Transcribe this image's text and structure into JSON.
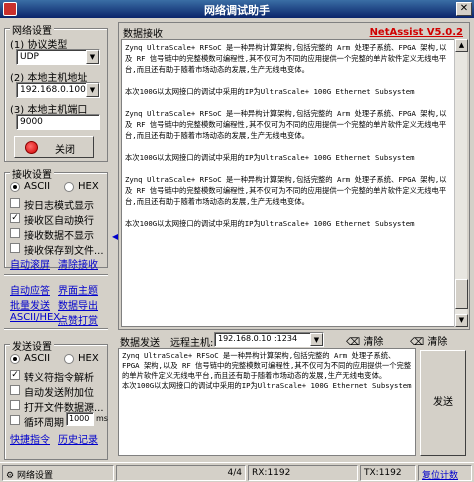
{
  "window": {
    "title": "网络调试助手",
    "close": "✕"
  },
  "net_settings": {
    "legend": "网络设置",
    "protocol_label": "(1) 协议类型",
    "protocol_value": "UDP",
    "local_ip_label": "(2) 本地主机地址",
    "local_ip_value": "192.168.0.100",
    "local_port_label": "(3) 本地主机端口",
    "local_port_value": "9000",
    "open_button": "关闭"
  },
  "recv_settings": {
    "legend": "接收设置",
    "ascii": "ASCII",
    "hex": "HEX",
    "options": [
      "按日志模式显示",
      "接收区自动换行",
      "接收数据不显示",
      "接收保存到文件..."
    ],
    "checked": [
      false,
      true,
      false,
      false
    ],
    "auto_scroll": "自动滚屏",
    "clear_recv": "清除接收"
  },
  "mid_links": {
    "row1": [
      "自动应答",
      "界面主题"
    ],
    "row2": [
      "批量发送",
      "数据导出"
    ],
    "row3": [
      "ASCII/HEX",
      "点赞打赏"
    ]
  },
  "send_settings": {
    "legend": "发送设置",
    "ascii": "ASCII",
    "hex": "HEX",
    "options": [
      "转义符指令解析",
      "自动发送附加位",
      "打开文件数据源...",
      "循环周期"
    ],
    "checked": [
      true,
      false,
      false,
      false
    ],
    "cycle_value": "1000",
    "cycle_unit": "ms",
    "quick_cmd": "快捷指令",
    "history": "历史记录"
  },
  "receive_panel": {
    "title": "数据接收",
    "brand": "NetAssist V5.0.2",
    "paragraphs": [
      "Zynq UltraScale+ RFSoC 是一种异构计算架构,包括完整的 Arm 处理子系统、FPGA 架构,以及 RF 信号链中的完整模数可编程性,其不仅可为不同的应用提供一个完整的单片软件定义无线电平台,而且还有助于随着市场动态的发展,生产无线电变体。",
      "本次100G以太网接口的调试中采用的IP为UltraScale+ 100G Ethernet Subsystem",
      "Zynq UltraScale+ RFSoC 是一种异构计算架构,包括完整的 Arm 处理子系统、FPGA 架构,以及 RF 信号链中的完整模数可编程性,其不仅可为不同的应用提供一个完整的单片软件定义无线电平台,而且还有助于随着市场动态的发展,生产无线电变体。",
      "本次100G以太网接口的调试中采用的IP为UltraScale+ 100G Ethernet Subsystem",
      "Zynq UltraScale+ RFSoC 是一种异构计算架构,包括完整的 Arm 处理子系统、FPGA 架构,以及 RF 信号链中的完整模数可编程性,其不仅可为不同的应用提供一个完整的单片软件定义无线电平台,而且还有助于随着市场动态的发展,生产无线电变体。",
      "本次100G以太网接口的调试中采用的IP为UltraScale+ 100G Ethernet Subsystem"
    ]
  },
  "send_panel": {
    "title": "数据发送",
    "remote_label": "远程主机:",
    "remote_value": "192.168.0.10 :1234",
    "clear_left": "清除",
    "clear_right": "清除",
    "text": "Zynq UltraScale+ RFSoC 是一种异构计算架构,包括完整的 Arm 处理子系统、FPGA 架构,以及 RF 信号链中的完整模数可编程性,其不仅可为不同的应用提供一个完整的单片软件定义无线电平台,而且还有助于随着市场动态的发展,生产无线电变体。\n本次100G以太网接口的调试中采用的IP为UltraScale+ 100G Ethernet Subsystem",
    "send_button": "发送"
  },
  "statusbar": {
    "net_settings": "网络设置",
    "page": "4/4",
    "rx": "RX:1192",
    "tx": "TX:1192",
    "reset": "复位计数"
  }
}
